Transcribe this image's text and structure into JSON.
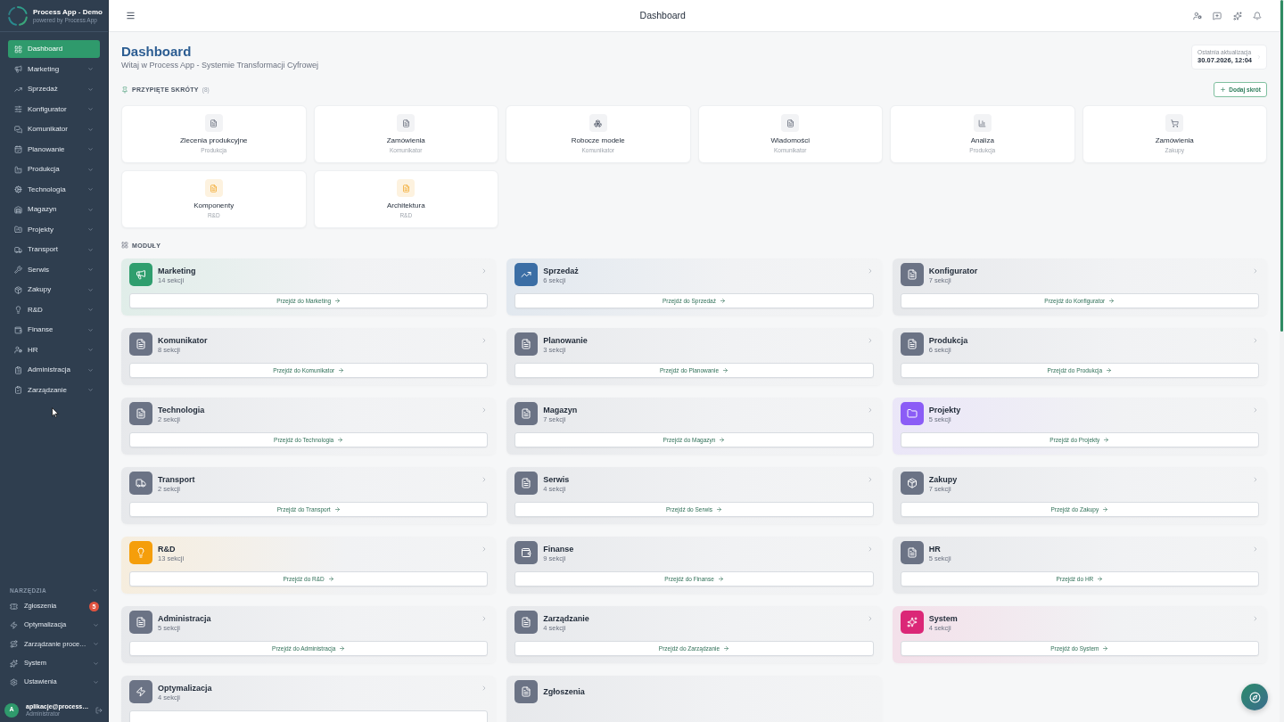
{
  "sidebar": {
    "brand": {
      "title": "Process App - Demo",
      "subtitle": "powered by Process App"
    },
    "items": [
      {
        "label": "Dashboard",
        "kind": "link",
        "selected": true
      },
      {
        "label": "Marketing",
        "kind": "group",
        "selected": false
      },
      {
        "label": "Sprzedaż",
        "kind": "group",
        "selected": false
      },
      {
        "label": "Konfigurator",
        "kind": "group",
        "selected": false
      },
      {
        "label": "Komunikator",
        "kind": "group",
        "selected": false
      },
      {
        "label": "Planowanie",
        "kind": "group",
        "selected": false
      },
      {
        "label": "Produkcja",
        "kind": "group",
        "selected": false
      },
      {
        "label": "Technologia",
        "kind": "group",
        "selected": false
      },
      {
        "label": "Magazyn",
        "kind": "group",
        "selected": false
      },
      {
        "label": "Projekty",
        "kind": "group",
        "selected": false
      },
      {
        "label": "Transport",
        "kind": "group",
        "selected": false
      },
      {
        "label": "Serwis",
        "kind": "group",
        "selected": false
      },
      {
        "label": "Zakupy",
        "kind": "group",
        "selected": false
      },
      {
        "label": "R&D",
        "kind": "group",
        "selected": false
      },
      {
        "label": "Finanse",
        "kind": "group",
        "selected": false
      },
      {
        "label": "HR",
        "kind": "group",
        "selected": false
      },
      {
        "label": "Administracja",
        "kind": "group",
        "selected": false
      },
      {
        "label": "Zarządzanie",
        "kind": "group",
        "selected": false
      }
    ],
    "tools": {
      "title": "NARZĘDZIA",
      "items": [
        {
          "label": "Zgłoszenia",
          "kind": "link",
          "badge": "5"
        },
        {
          "label": "Optymalizacja",
          "kind": "group"
        },
        {
          "label": "Zarządzanie proce…",
          "kind": "group"
        },
        {
          "label": "System",
          "kind": "group"
        },
        {
          "label": "Ustawienia",
          "kind": "group"
        }
      ]
    },
    "user": {
      "initial": "A",
      "email": "aplikacje@process…",
      "role": "Administrator"
    }
  },
  "header": {
    "title": "Dashboard"
  },
  "page": {
    "title": "Dashboard",
    "subtitle": "Witaj w Process App - Systemie Transformacji Cyfrowej",
    "last_update": {
      "label": "Ostatnia aktualizacja",
      "value": "30.07.2026, 12:04"
    }
  },
  "shortcuts": {
    "title": "PRZYPIĘTE SKRÓTY",
    "count": "(8)",
    "add_button": "Dodaj skrót",
    "items": [
      {
        "title": "Zlecenia produkcyjne",
        "module": "Produkcja",
        "color": "#f2f3f5"
      },
      {
        "title": "Zamówienia",
        "module": "Komunikator",
        "color": "#f2f3f5"
      },
      {
        "title": "Robocze modele",
        "module": "Komunikator",
        "color": "#f2f3f5"
      },
      {
        "title": "Wiadomości",
        "module": "Komunikator",
        "color": "#f2f3f5"
      },
      {
        "title": "Analiza",
        "module": "Produkcja",
        "color": "#f2f3f5"
      },
      {
        "title": "Zamówienia",
        "module": "Zakupy",
        "color": "#f2f3f5"
      },
      {
        "title": "Komponenty",
        "module": "R&D",
        "color": "#fdf2df"
      },
      {
        "title": "Architektura",
        "module": "R&D",
        "color": "#fdf2df"
      }
    ]
  },
  "modules": {
    "title": "MODUŁY",
    "items": [
      {
        "name": "Marketing",
        "sections": "14 sekcji",
        "button": "Przejdź do Marketing",
        "color": "#2f9e6e"
      },
      {
        "name": "Sprzedaż",
        "sections": "6 sekcji",
        "button": "Przejdź do Sprzedaż",
        "color": "#3b6ea5"
      },
      {
        "name": "Konfigurator",
        "sections": "7 sekcji",
        "button": "Przejdź do Konfigurator",
        "color": "#6b7385"
      },
      {
        "name": "Komunikator",
        "sections": "8 sekcji",
        "button": "Przejdź do Komunikator",
        "color": "#6b7385"
      },
      {
        "name": "Planowanie",
        "sections": "3 sekcji",
        "button": "Przejdź do Planowanie",
        "color": "#6b7385"
      },
      {
        "name": "Produkcja",
        "sections": "6 sekcji",
        "button": "Przejdź do Produkcja",
        "color": "#6b7385"
      },
      {
        "name": "Technologia",
        "sections": "2 sekcji",
        "button": "Przejdź do Technologia",
        "color": "#6b7385"
      },
      {
        "name": "Magazyn",
        "sections": "7 sekcji",
        "button": "Przejdź do Magazyn",
        "color": "#6b7385"
      },
      {
        "name": "Projekty",
        "sections": "5 sekcji",
        "button": "Przejdź do Projekty",
        "color": "#8b5cf6"
      },
      {
        "name": "Transport",
        "sections": "2 sekcji",
        "button": "Przejdź do Transport",
        "color": "#6b7385"
      },
      {
        "name": "Serwis",
        "sections": "4 sekcji",
        "button": "Przejdź do Serwis",
        "color": "#6b7385"
      },
      {
        "name": "Zakupy",
        "sections": "7 sekcji",
        "button": "Przejdź do Zakupy",
        "color": "#6b7385"
      },
      {
        "name": "R&D",
        "sections": "13 sekcji",
        "button": "Przejdź do R&D",
        "color": "#f59e0b"
      },
      {
        "name": "Finanse",
        "sections": "9 sekcji",
        "button": "Przejdź do Finanse",
        "color": "#6b7385"
      },
      {
        "name": "HR",
        "sections": "5 sekcji",
        "button": "Przejdź do HR",
        "color": "#6b7385"
      },
      {
        "name": "Administracja",
        "sections": "5 sekcji",
        "button": "Przejdź do Administracja",
        "color": "#6b7385"
      },
      {
        "name": "Zarządzanie",
        "sections": "4 sekcji",
        "button": "Przejdź do Zarządzanie",
        "color": "#6b7385"
      },
      {
        "name": "System",
        "sections": "4 sekcji",
        "button": "Przejdź do System",
        "color": "#db2777"
      },
      {
        "name": "Optymalizacja",
        "sections": "4 sekcji",
        "color": "#6b7385"
      },
      {
        "name": "Zgłoszenia",
        "color": "#6b7385"
      }
    ]
  }
}
